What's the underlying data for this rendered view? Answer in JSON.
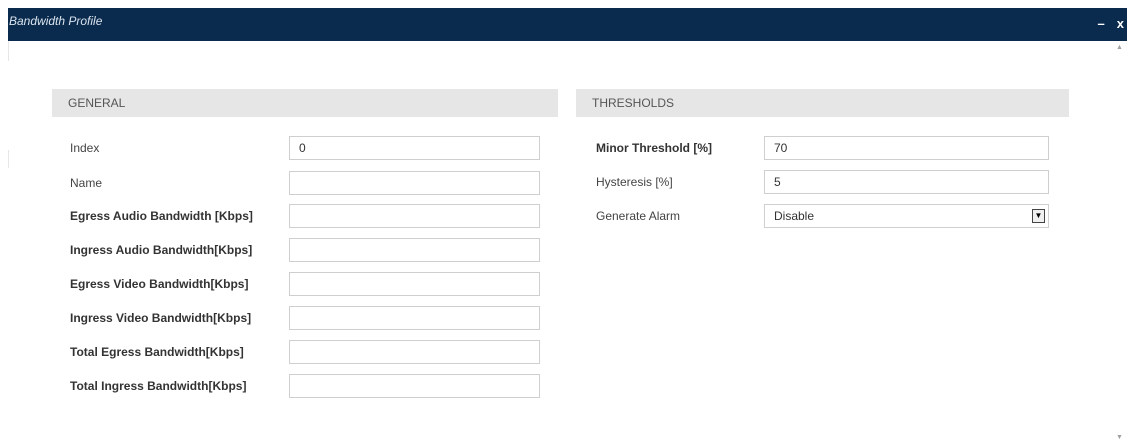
{
  "window": {
    "title": "Bandwidth Profile",
    "minimize_label": "–",
    "close_label": "x"
  },
  "general": {
    "header": "GENERAL",
    "fields": [
      {
        "label": "Index",
        "value": "0"
      },
      {
        "label": "Name",
        "value": ""
      },
      {
        "label": "Egress Audio Bandwidth [Kbps]",
        "value": ""
      },
      {
        "label": "Ingress Audio Bandwidth[Kbps]",
        "value": ""
      },
      {
        "label": "Egress Video Bandwidth[Kbps]",
        "value": ""
      },
      {
        "label": "Ingress Video Bandwidth[Kbps]",
        "value": ""
      },
      {
        "label": "Total Egress Bandwidth[Kbps]",
        "value": ""
      },
      {
        "label": "Total Ingress Bandwidth[Kbps]",
        "value": ""
      }
    ]
  },
  "thresholds": {
    "header": "THRESHOLDS",
    "fields": [
      {
        "label": "Minor Threshold [%]",
        "value": "70"
      },
      {
        "label": "Hysteresis [%]",
        "value": "5"
      },
      {
        "label": "Generate Alarm",
        "value": "Disable"
      }
    ]
  },
  "icons": {
    "scroll_up": "scroll-up-arrow-icon",
    "scroll_down": "scroll-down-arrow-icon",
    "select_arrow": "chevron-down-icon"
  }
}
